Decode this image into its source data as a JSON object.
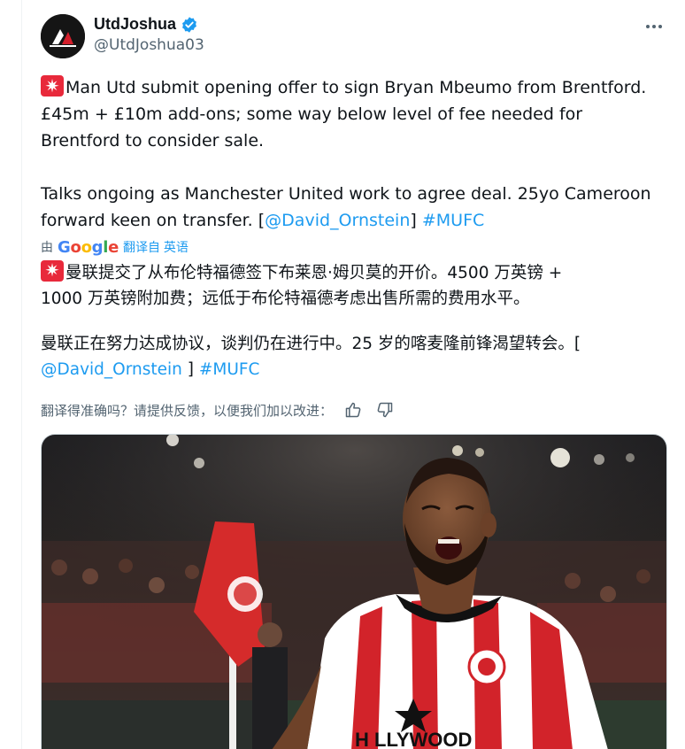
{
  "author": {
    "display_name": "UtdJoshua",
    "handle": "@UtdJoshua03",
    "verified": true
  },
  "tweet": {
    "lines_en": [
      "Man Utd submit opening offer to sign Bryan Mbeumo from Brentford.",
      "£45m + £10m add-ons; some way below level of fee needed for",
      "Brentford to consider sale."
    ],
    "para2_line1": "Talks ongoing as Manchester United work to agree deal. 25yo Cameroon",
    "para2_line2_prefix": "forward keen on transfer. [",
    "mention": "@David_Ornstein",
    "para2_line2_close": "]",
    "hashtag": "#MUFC"
  },
  "translation": {
    "by_label": "由",
    "google_letters": [
      "G",
      "o",
      "o",
      "g",
      "l",
      "e"
    ],
    "translated_from": "翻译自 英语",
    "zh_line1": "曼联提交了从布伦特福德签下布莱恩·姆贝莫的开价。4500 万英镑 +",
    "zh_line2": "1000 万英镑附加费；远低于布伦特福德考虑出售所需的费用水平。",
    "zh_para2_line1": "曼联正在努力达成协议，谈判仍在进行中。25 岁的喀麦隆前锋渴望转会。[",
    "zh_mention": "@David_Ornstein",
    "zh_close": " ]",
    "zh_hashtag": "#MUFC",
    "feedback_prompt": "翻译得准确吗？请提供反馈，以便我们加以改进："
  },
  "media": {
    "description_icons": [
      "soccer-player-photo"
    ],
    "jersey_text": "H LLYWOOD"
  },
  "colors": {
    "link": "#1d9bf0",
    "verified": "#1d9bf0",
    "siren": "#e8293b",
    "secondary_text": "#536471"
  }
}
